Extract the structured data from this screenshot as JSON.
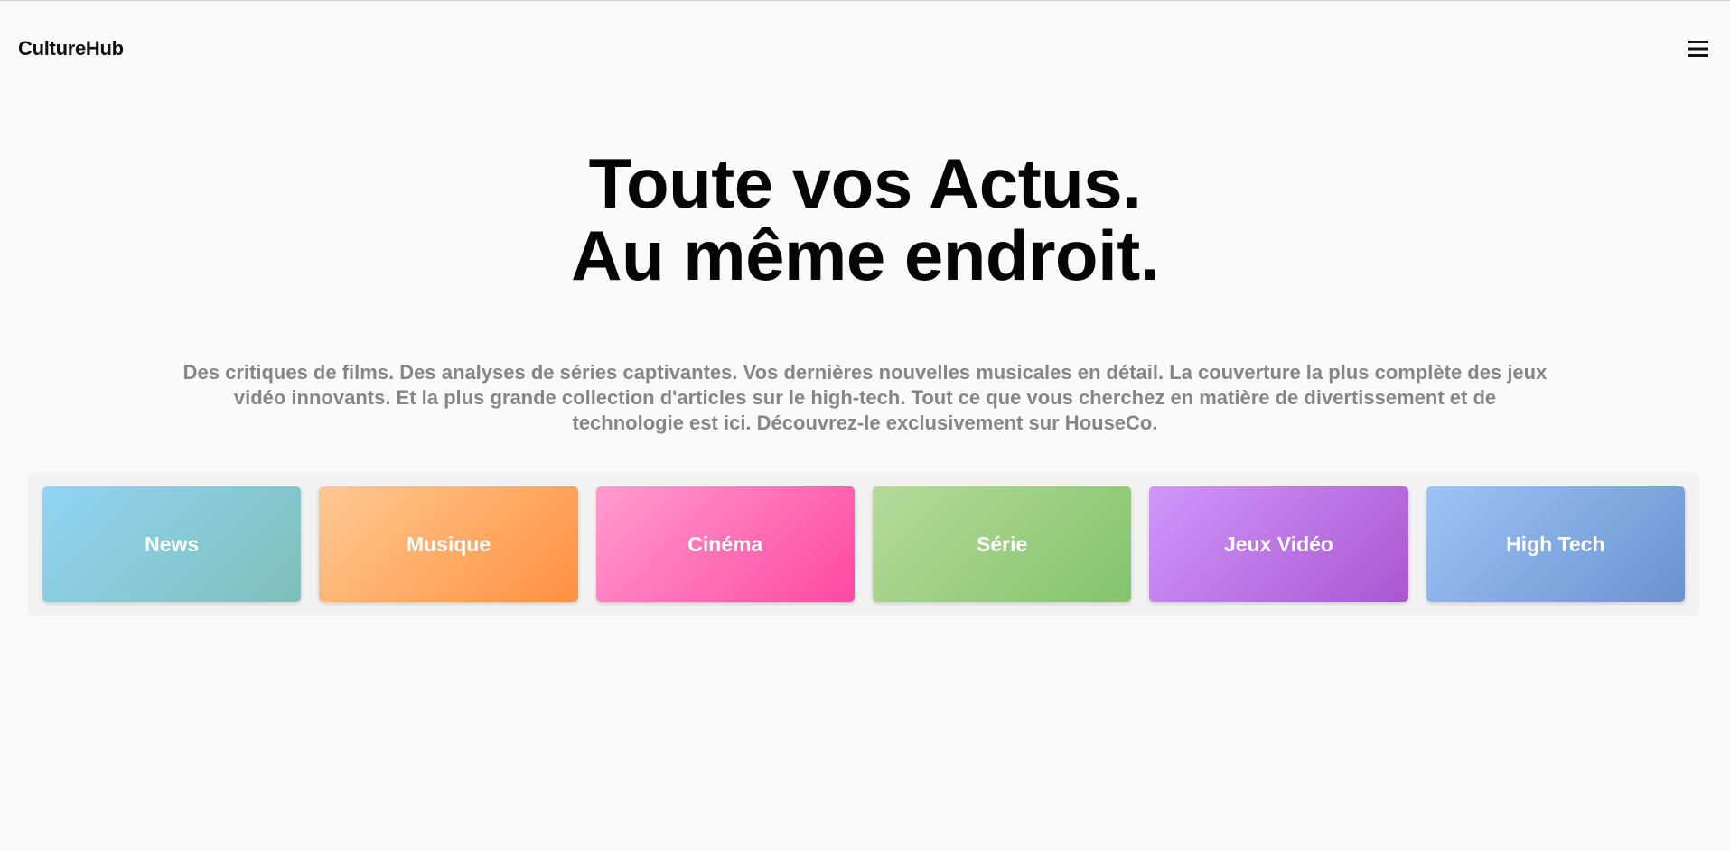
{
  "header": {
    "brand": "CultureHub",
    "menu_icon": "hamburger-menu-icon"
  },
  "hero": {
    "title_line1": "Toute vos Actus.",
    "title_line2": "Au même endroit.",
    "description": "Des critiques de films. Des analyses de séries captivantes. Vos dernières nouvelles musicales en détail. La couverture la plus complète des jeux vidéo innovants. Et la plus grande collection d'articles sur le high-tech. Tout ce que vous cherchez en matière de divertissement et de technologie est ici. Découvrez-le exclusivement sur HouseCo."
  },
  "categories": [
    {
      "label": "News",
      "color_start": "#90d4f5",
      "color_end": "#7fbfb8"
    },
    {
      "label": "Musique",
      "color_start": "#ffc992",
      "color_end": "#ff9040"
    },
    {
      "label": "Cinéma",
      "color_start": "#ff9ccd",
      "color_end": "#ff48a2"
    },
    {
      "label": "Série",
      "color_start": "#b6d99a",
      "color_end": "#82c46c"
    },
    {
      "label": "Jeux Vidéo",
      "color_start": "#d096fb",
      "color_end": "#a957cf"
    },
    {
      "label": "High Tech",
      "color_start": "#9cc4f7",
      "color_end": "#6a92cf"
    }
  ]
}
